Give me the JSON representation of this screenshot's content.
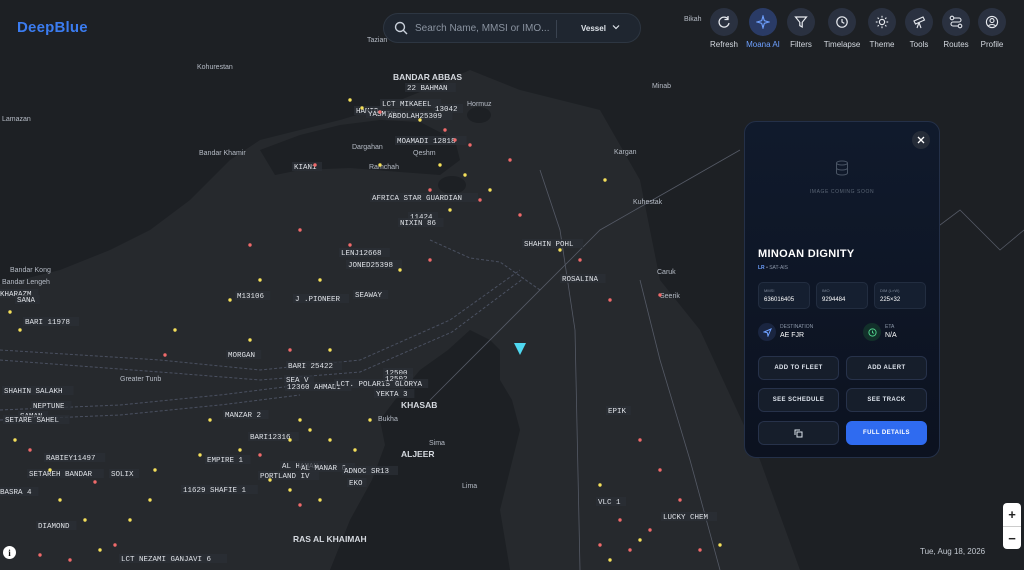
{
  "brand": "DeepBlue",
  "search": {
    "placeholder": "Search Name, MMSI or IMO...",
    "type": "Vessel"
  },
  "toolbar": [
    {
      "label": "Refresh",
      "icon": "refresh-icon"
    },
    {
      "label": "Moana AI",
      "icon": "sparkle-icon",
      "active": true
    },
    {
      "label": "Filters",
      "icon": "filter-icon"
    },
    {
      "label": "Timelapse",
      "icon": "timelapse-icon"
    },
    {
      "label": "Theme",
      "icon": "sun-icon"
    },
    {
      "label": "Tools",
      "icon": "telescope-icon"
    },
    {
      "label": "Routes",
      "icon": "route-icon"
    },
    {
      "label": "Profile",
      "icon": "user-icon"
    }
  ],
  "panel": {
    "image_placeholder": "IMAGE COMING SOON",
    "vessel_name": "MINOAN DIGNITY",
    "flag": "LR",
    "source": "SAT-AIS",
    "stats": [
      {
        "label": "MMSI",
        "value": "636016405"
      },
      {
        "label": "IMO",
        "value": "9294484"
      },
      {
        "label": "DIM (L×W)",
        "value": "225×32"
      }
    ],
    "destination": {
      "label": "DESTINATION",
      "value": "AE FJR"
    },
    "eta": {
      "label": "ETA",
      "value": "N/A"
    },
    "buttons": {
      "add_to_fleet": "ADD TO FLEET",
      "add_alert": "ADD ALERT",
      "see_schedule": "SEE SCHEDULE",
      "see_track": "SEE TRACK",
      "full_details": "FULL DETAILS"
    }
  },
  "date": "Tue, Aug 18, 2026",
  "zoom": {
    "in": "+",
    "out": "−"
  },
  "map": {
    "place_labels": [
      "Bikah",
      "Tazian",
      "Kohurestan",
      "BANDAR ABBAS",
      "Minab",
      "Hormuz",
      "Lamazan",
      "Bandar Khamir",
      "Dargahan",
      "Qeshm",
      "Kargan",
      "Ramchah",
      "Kuhestak",
      "Bandar Kong",
      "Bandar Lengeh",
      "Caruk",
      "Seerik",
      "Greater Tunb",
      "KHASAB",
      "Bukha",
      "Sima",
      "ALJEER",
      "Lima",
      "RAS AL KHAIMAH"
    ],
    "vessel_labels": [
      "22 BAHMAN",
      "LCT MIKAEEL",
      "13042",
      "HAMID",
      "YASMIN",
      "ABDOLAH25309",
      "MOAMADI 12818",
      "KIAN1",
      "AFRICA STAR GUARDIAN",
      "11424",
      "NIXIN 86",
      "SHAHIN POHL",
      "LENJ12668",
      "JONED25398",
      "ROSALINA",
      "M13106",
      "J .PIONEER",
      "SEAWAY",
      "KHARAZM",
      "SANA",
      "BARI 11978",
      "MORGAN",
      "BARI 25422",
      "SEA V",
      "12360 AHMADI",
      "LCT. POLARIS",
      "12500",
      "12502",
      "GLORYA",
      "YEKTA 3",
      "SHAHIN SALAKH",
      "NEPTUNE",
      "SAMAN",
      "SETARE SAHEL",
      "MANZAR 2",
      "BARI12316",
      "RABIEY11497",
      "SETAREH BANDAR",
      "SOLIX",
      "EMPIRE 1",
      "AL HAMAH",
      "AL MANAR 6",
      "PORTLAND IV",
      "ADNOC SR13",
      "EKO",
      "BASRA 4",
      "11629 SHAFIE 1",
      "DIAMOND",
      "LCT NEZAMI GANJAVI 6",
      "EPIK",
      "VLC 1",
      "LUCKY CHEM"
    ]
  },
  "colors": {
    "accent": "#3b7cf0",
    "primary_button": "#2f6bf0",
    "selected_vessel": "#4fd8f0",
    "cargo_marker": "#f5e05a",
    "tanker_marker": "#f06a6a"
  }
}
